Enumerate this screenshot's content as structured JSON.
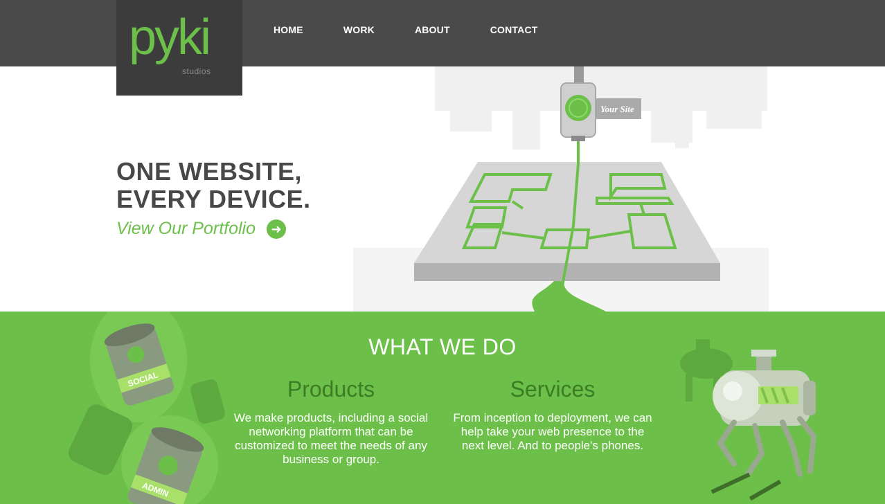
{
  "header": {
    "logo_text": "pyki",
    "logo_sub": "studios",
    "nav": [
      {
        "label": "HOME"
      },
      {
        "label": "WORK"
      },
      {
        "label": "ABOUT"
      },
      {
        "label": "CONTACT"
      }
    ]
  },
  "hero": {
    "headline_line1": "ONE WEBSITE,",
    "headline_line2": "EVERY DEVICE.",
    "cta_label": "View Our Portfolio",
    "usb_label": "Your Site"
  },
  "what_we_do": {
    "title": "WHAT WE DO",
    "products": {
      "heading": "Products",
      "text": "We make products, including a social networking platform that can be customized to meet the needs of any business or group."
    },
    "services": {
      "heading": "Services",
      "text": "From inception to deployment, we can help take your web presence to the next level. And to people's phones."
    },
    "barrel_labels": [
      "SOCIAL",
      "ADMIN"
    ]
  },
  "colors": {
    "brand_green": "#6cc04a",
    "dark_green": "#3b7d23",
    "header_gray": "#4a4a4a",
    "text_dark": "#484848"
  }
}
